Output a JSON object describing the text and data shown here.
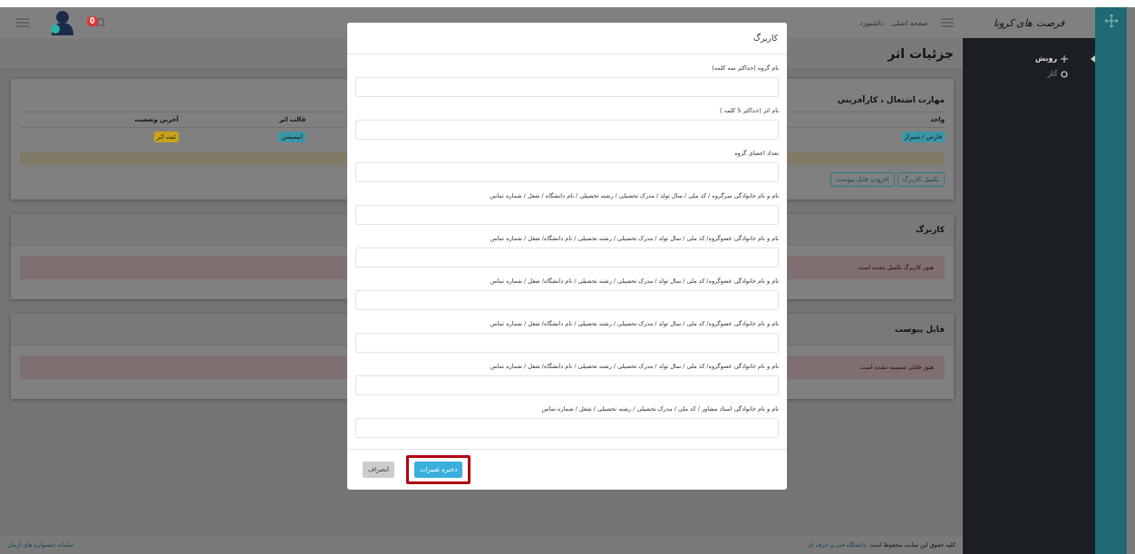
{
  "navbar": {
    "brand": "فرصت های کرونا",
    "links": [
      "صفحه اصلی",
      "داشبورد"
    ],
    "notification_count": "0"
  },
  "sidebar": {
    "items": [
      {
        "label": "رویش",
        "kind": "plus",
        "selected": true
      },
      {
        "label": "آثار",
        "kind": "circle",
        "selected": false
      }
    ]
  },
  "page_title": "جزئیات اثر",
  "work_card": {
    "title": "مهارت اشتغال ، کارآفرینی",
    "columns": [
      "واحد",
      "قالب اثر",
      "آخرین وضعیت"
    ],
    "cells": [
      {
        "text": "فارس / شیراز",
        "color": "#3a97a8"
      },
      {
        "text": "انیمیشن",
        "color": "#3a97a8"
      },
      {
        "text": "ثبت اثر",
        "color": "#c9a21a"
      }
    ],
    "buttons": [
      "تکمیل کاربرگ",
      "افزودن فایل پیوست"
    ]
  },
  "sections": [
    {
      "title": "کاربرگ",
      "alert": "هنوز کاربرگ تکمیل نشده است"
    },
    {
      "title": "فایل پیوست",
      "alert": "هنوز فایلی ضمیمه نشده است"
    }
  ],
  "footer": {
    "copyright": "کلیه حقوق این سایت محفوظ است",
    "link": "دانشگاه فنی و حرفه ای",
    "system_name": "سامانه جشنواره های آرمان"
  },
  "modal": {
    "title": "کاربرگ",
    "fields": [
      {
        "label": "نام گروه (حداکثر سه کلمه)"
      },
      {
        "label": "نام اثر (حداکثر 5 کلمه )"
      },
      {
        "label": "تعداد اعضای گروه"
      },
      {
        "label": "نام و نام خانوادگی سرگروه / کد ملی / سال تولد / مدرک تحصیلی / رشته تحصیلی / نام دانشگاه / شغل / شماره تماس"
      },
      {
        "label": "نام و نام خانوادگی عضوگروه/ کد ملی / سال تولد / مدرک تحصیلی / رشته تحصیلی / نام دانشگاه/ شغل / شماره تماس"
      },
      {
        "label": "نام و نام خانوادگی عضوگروه/ کد ملی / سال تولد / مدرک تحصیلی / رشته تحصیلی / نام دانشگاه/ شغل / شماره تماس"
      },
      {
        "label": "نام و نام خانوادگی عضوگروه/ کد ملی / سال تولد / مدرک تحصیلی / رشته تحصیلی / نام دانشگاه/ شغل / شماره تماس"
      },
      {
        "label": "نام و نام خانوادگی عضوگروه/ کد ملی / سال تولد / مدرک تحصیلی / رشته تحصیلی / نام دانشگاه/ شغل / شماره تماس"
      },
      {
        "label": "نام و نام خانوادگی استاد مشاور / کد ملی / مدرک تحصیلی / رشته تحصیلی / شغل / شماره تماس"
      }
    ],
    "buttons": [
      {
        "label": "ذخیره تغییرات",
        "kind": "primary",
        "highlighted": true
      },
      {
        "label": "انصراف",
        "kind": "secondary",
        "highlighted": false
      }
    ]
  }
}
